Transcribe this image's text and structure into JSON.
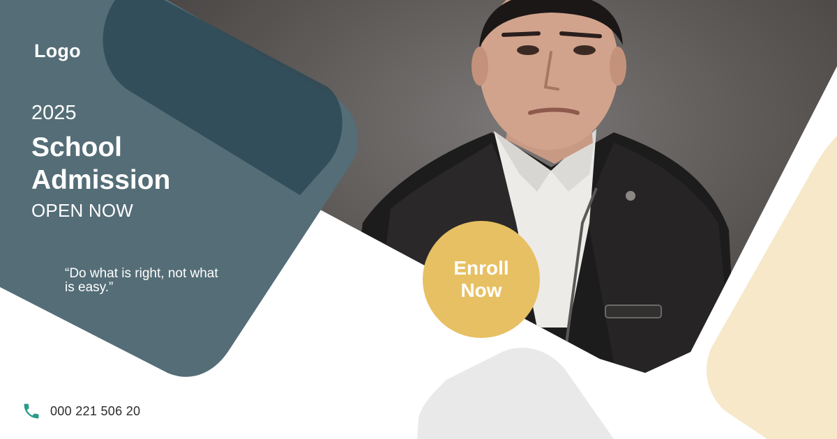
{
  "brand": {
    "logo_text": "Logo"
  },
  "hero": {
    "year": "2025",
    "title_line1": "School",
    "title_line2": "Admission",
    "subtitle": "OPEN NOW",
    "quote": "“Do what is right, not what is easy.”"
  },
  "cta": {
    "label_line1": "Enroll",
    "label_line2": "Now"
  },
  "contact": {
    "icon": "phone-icon",
    "phone": "000 221 506 20"
  },
  "colors": {
    "slate_dark": "#2f4a56",
    "slate": "#546d77",
    "gold": "#e7c063",
    "cream": "#f6e8c8",
    "light_gray": "#e9e9e9",
    "icon_teal": "#2b9c8a"
  }
}
